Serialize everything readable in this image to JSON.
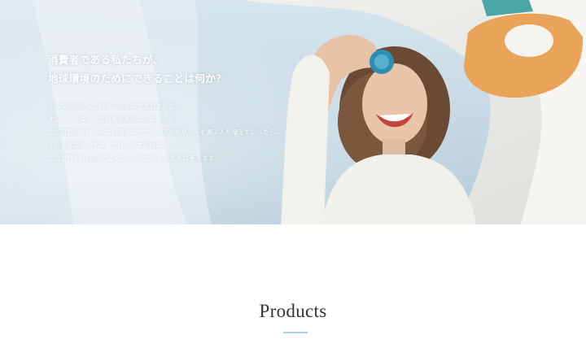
{
  "hero": {
    "headline": [
      "消費者である私たちが、",
      "地球環境のためにできることは何か？"
    ],
    "body": [
      "そんな視点からこのブランドは生まれました。",
      "オシャレを楽しむ気持ちを大切にしながらも、",
      "ただ可愛いだけじゃない環境にやさしいアクセサリーを選ぶ人が増えていったら…",
      "その変化は少しずつ、だけども本質的に、",
      "この世界をHappyに変えていくのだと、私たちは考えます。"
    ]
  },
  "products": {
    "title": "Products",
    "underline_color": "#a9cfe2"
  }
}
